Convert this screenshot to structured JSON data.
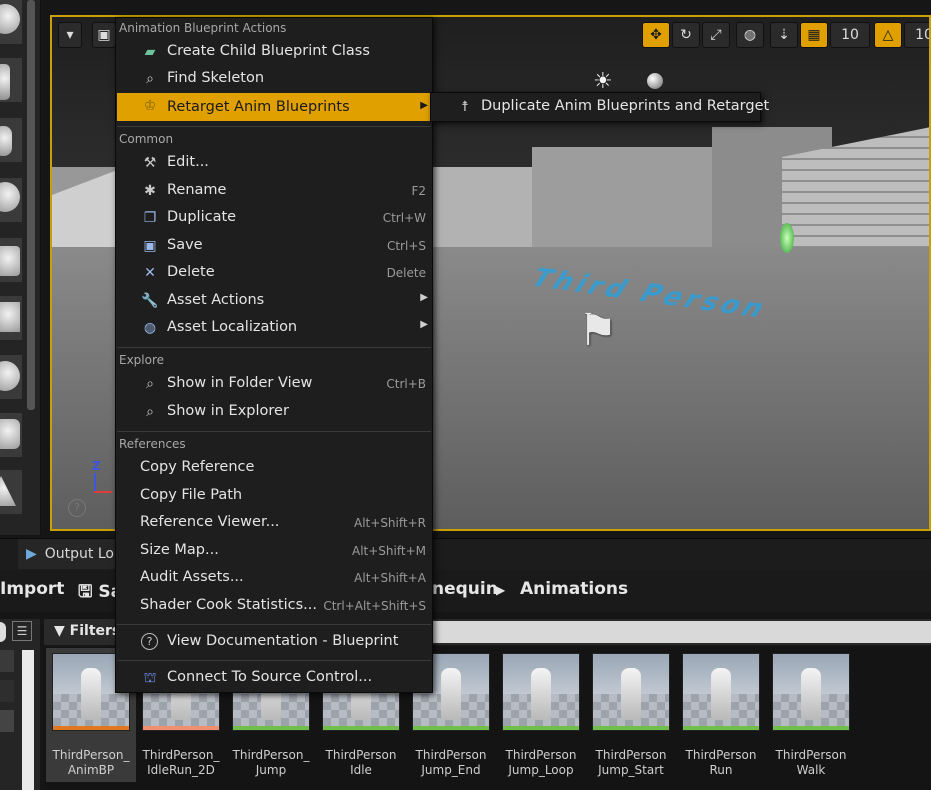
{
  "context_menu": {
    "section_blueprint": "Animation Blueprint Actions",
    "create_child": "Create Child Blueprint Class",
    "find_skeleton": "Find Skeleton",
    "retarget": "Retarget Anim Blueprints",
    "section_common": "Common",
    "edit": "Edit...",
    "rename": {
      "label": "Rename",
      "shortcut": "F2"
    },
    "duplicate": {
      "label": "Duplicate",
      "shortcut": "Ctrl+W"
    },
    "save": {
      "label": "Save",
      "shortcut": "Ctrl+S"
    },
    "delete": {
      "label": "Delete",
      "shortcut": "Delete"
    },
    "asset_actions": "Asset Actions",
    "asset_localization": "Asset Localization",
    "section_explore": "Explore",
    "show_folder": {
      "label": "Show in Folder View",
      "shortcut": "Ctrl+B"
    },
    "show_explorer": "Show in Explorer",
    "section_references": "References",
    "copy_reference": "Copy Reference",
    "copy_file_path": "Copy File Path",
    "reference_viewer": {
      "label": "Reference Viewer...",
      "shortcut": "Alt+Shift+R"
    },
    "size_map": {
      "label": "Size Map...",
      "shortcut": "Alt+Shift+M"
    },
    "audit_assets": {
      "label": "Audit Assets...",
      "shortcut": "Alt+Shift+A"
    },
    "shader_cook": {
      "label": "Shader Cook Statistics...",
      "shortcut": "Ctrl+Alt+Shift+S"
    },
    "view_docs": "View Documentation - Blueprint",
    "source_control": "Connect To Source Control..."
  },
  "submenu": {
    "duplicate_retarget": "Duplicate Anim Blueprints and Retarget"
  },
  "viewport": {
    "snap_value": "10",
    "rot_value": "10",
    "axis_z": "Z",
    "floor_text": "Third Person"
  },
  "bottom": {
    "tab_output": "Output Lo",
    "import": "Import",
    "save_all": "Sa",
    "path_mannequin": "nequin",
    "path_animations": "Animations",
    "filters": "Filters"
  },
  "assets": [
    {
      "name": "ThirdPerson_\nAnimBP",
      "stripe": "#e07820"
    },
    {
      "name": "ThirdPerson_\nIdleRun_2D",
      "stripe": "#f09070"
    },
    {
      "name": "ThirdPerson_\nJump",
      "stripe": "#6fbf4a"
    },
    {
      "name": "ThirdPerson\nIdle",
      "stripe": "#6fbf4a"
    },
    {
      "name": "ThirdPerson\nJump_End",
      "stripe": "#6fbf4a"
    },
    {
      "name": "ThirdPerson\nJump_Loop",
      "stripe": "#6fbf4a"
    },
    {
      "name": "ThirdPerson\nJump_Start",
      "stripe": "#6fbf4a"
    },
    {
      "name": "ThirdPerson\nRun",
      "stripe": "#6fbf4a"
    },
    {
      "name": "ThirdPerson\nWalk",
      "stripe": "#6fbf4a"
    }
  ],
  "colors": {
    "highlight": "#e0a000",
    "menu_bg": "#1e1e1e"
  },
  "icons": [
    "blueprint-class-icon",
    "search-icon",
    "retarget-icon",
    "edit-icon",
    "rename-icon",
    "duplicate-icon",
    "save-icon",
    "delete-icon",
    "wrench-icon",
    "globe-icon",
    "help-icon",
    "source-control-icon",
    "skeleton-icon"
  ]
}
